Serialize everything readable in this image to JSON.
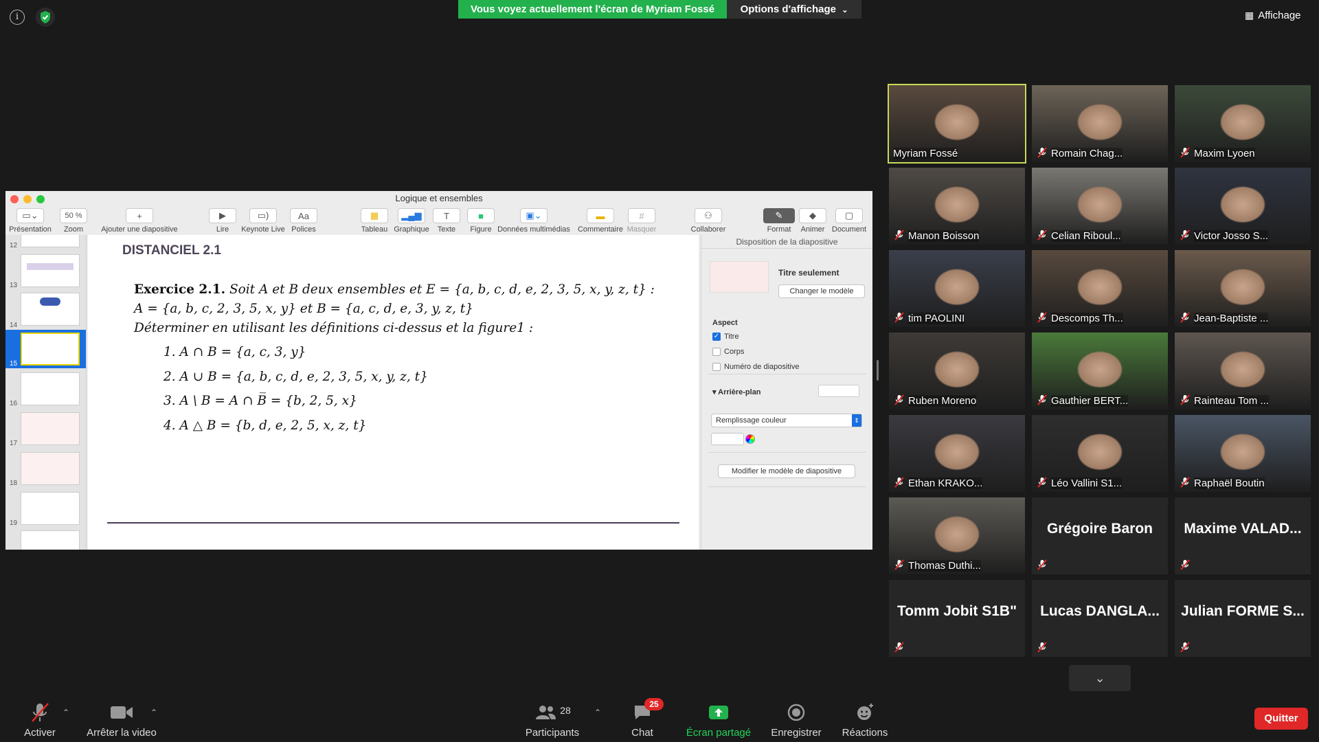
{
  "banner": {
    "sharing_text": "Vous voyez actuellement l'écran de Myriam Fossé",
    "options_label": "Options d'affichage"
  },
  "view_label": "Affichage",
  "keynote": {
    "window_title": "Logique et ensembles",
    "toolbar": {
      "presentation": "Présentation",
      "zoom_value": "50 %",
      "zoom": "Zoom",
      "add_slide": "Ajouter une diapositive",
      "play": "Lire",
      "keynote_live": "Keynote Live",
      "fonts": "Polices",
      "table": "Tableau",
      "chart": "Graphique",
      "text": "Texte",
      "shape": "Figure",
      "media": "Données multimédias",
      "comment": "Commentaire",
      "mask": "Masquer",
      "collaborate": "Collaborer",
      "format": "Format",
      "animate": "Animer",
      "document": "Document"
    },
    "slide_numbers": [
      "12",
      "13",
      "14",
      "15",
      "16",
      "17",
      "18",
      "19"
    ],
    "slide": {
      "title": "DISTANCIEL 2.1",
      "exercise_head": "Exercice 2.1.",
      "exercise_line1": "Soit A et B deux ensembles et E = {a, b, c, d, e, 2, 3, 5, x, y, z, t} :",
      "exercise_line2": "A = {a, b, c, 2, 3, 5, x, y} et B = {a, c, d, e, 3, y, z, t}",
      "exercise_line3": "Déterminer en utilisant les définitions ci-dessus et la figure1 :",
      "items": [
        "1.  A ∩ B = {a, c, 3, y}",
        "2.  A ∪ B = {a, b, c, d, e, 2, 3, 5, x, y, z, t}",
        "3.  A \\ B = A ∩ B̅ = {b, 2, 5, x}",
        "4.  A △ B = {b, d, e, 2, 5, x, z, t}"
      ]
    },
    "panel": {
      "header": "Disposition de la diapositive",
      "layout_name": "Titre seulement",
      "change_model": "Changer le modèle",
      "aspect": "Aspect",
      "opt_title": "Titre",
      "opt_body": "Corps",
      "opt_number": "Numéro de diapositive",
      "background": "Arrière-plan",
      "fill": "Remplissage couleur",
      "edit_model": "Modifier le modèle de diapositive"
    }
  },
  "participants_tiles": [
    {
      "name": "Myriam Fossé",
      "video": true
    },
    {
      "name": "Romain Chag...",
      "video": true
    },
    {
      "name": "Maxim Lyoen",
      "video": true
    },
    {
      "name": "Manon Boisson",
      "video": true
    },
    {
      "name": "Celian Riboul...",
      "video": true
    },
    {
      "name": "Victor Josso S...",
      "video": true
    },
    {
      "name": "tim PAOLINI",
      "video": true
    },
    {
      "name": "Descomps Th...",
      "video": true
    },
    {
      "name": "Jean-Baptiste ...",
      "video": true
    },
    {
      "name": "Ruben Moreno",
      "video": true
    },
    {
      "name": "Gauthier BERT...",
      "video": true
    },
    {
      "name": "Rainteau Tom ...",
      "video": true
    },
    {
      "name": "Ethan KRAKO...",
      "video": true
    },
    {
      "name": "Léo Vallini S1...",
      "video": true
    },
    {
      "name": "Raphaël Boutin",
      "video": true
    },
    {
      "name": "Thomas Duthi...",
      "video": true
    },
    {
      "name": "Grégoire Baron",
      "video": false
    },
    {
      "name": "Maxime  VALAD...",
      "video": false
    },
    {
      "name": "Tomm Jobit S1B\"",
      "video": false
    },
    {
      "name": "Lucas  DANGLA...",
      "video": false
    },
    {
      "name": "Julian  FORME  S...",
      "video": false
    }
  ],
  "bottom_bar": {
    "unmute": "Activer",
    "stop_video": "Arrêter la video",
    "participants_count": "28",
    "participants": "Participants",
    "chat": "Chat",
    "chat_badge": "25",
    "share": "Écran partagé",
    "record": "Enregistrer",
    "reactions": "Réactions",
    "quit": "Quitter"
  },
  "colors": {
    "share_green": "#23b14d",
    "active_speaker": "#c9d95a",
    "quit_red": "#e02828",
    "keynote_blue": "#1a6fe0"
  }
}
